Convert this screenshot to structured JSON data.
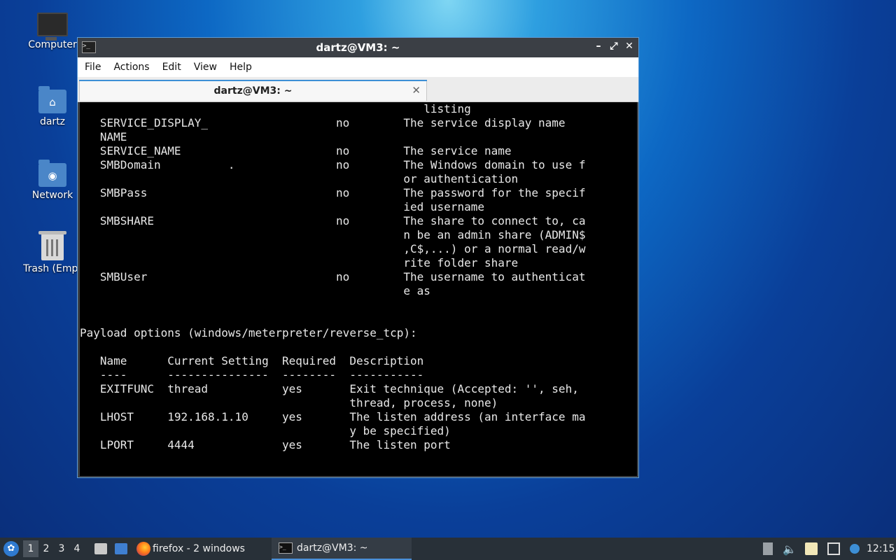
{
  "desktop": {
    "icons": [
      {
        "label": "Computer",
        "icon": "computer-icon"
      },
      {
        "label": "dartz",
        "icon": "home-folder-icon"
      },
      {
        "label": "Network",
        "icon": "network-folder-icon"
      },
      {
        "label": "Trash (Empt",
        "icon": "trash-icon"
      }
    ]
  },
  "window": {
    "title": "dartz@VM3: ~",
    "menu": [
      "File",
      "Actions",
      "Edit",
      "View",
      "Help"
    ],
    "tab_label": "dartz@VM3: ~",
    "terminal_lines": [
      "                                                   listing",
      "   SERVICE_DISPLAY_                   no        The service display name",
      "   NAME",
      "   SERVICE_NAME                       no        The service name",
      "   SMBDomain          .               no        The Windows domain to use f",
      "                                                or authentication",
      "   SMBPass                            no        The password for the specif",
      "                                                ied username",
      "   SMBSHARE                           no        The share to connect to, ca",
      "                                                n be an admin share (ADMIN$",
      "                                                ,C$,...) or a normal read/w",
      "                                                rite folder share",
      "   SMBUser                            no        The username to authenticat",
      "                                                e as",
      "",
      "",
      "Payload options (windows/meterpreter/reverse_tcp):",
      "",
      "   Name      Current Setting  Required  Description",
      "   ----      ---------------  --------  -----------",
      "   EXITFUNC  thread           yes       Exit technique (Accepted: '', seh,",
      "                                        thread, process, none)",
      "   LHOST     192.168.1.10     yes       The listen address (an interface ma",
      "                                        y be specified)",
      "   LPORT     4444             yes       The listen port"
    ]
  },
  "taskbar": {
    "workspaces": [
      "1",
      "2",
      "3",
      "4"
    ],
    "active_workspace": "1",
    "tasks": [
      {
        "label": "firefox - 2 windows",
        "icon": "firefox-icon"
      },
      {
        "label": "dartz@VM3: ~",
        "icon": "terminal-icon"
      }
    ],
    "clock": "12:15"
  },
  "colors": {
    "terminal_bg": "#000000",
    "terminal_fg": "#e8e8e8",
    "accent": "#3d8fd6",
    "taskbar_bg": "#283038"
  }
}
